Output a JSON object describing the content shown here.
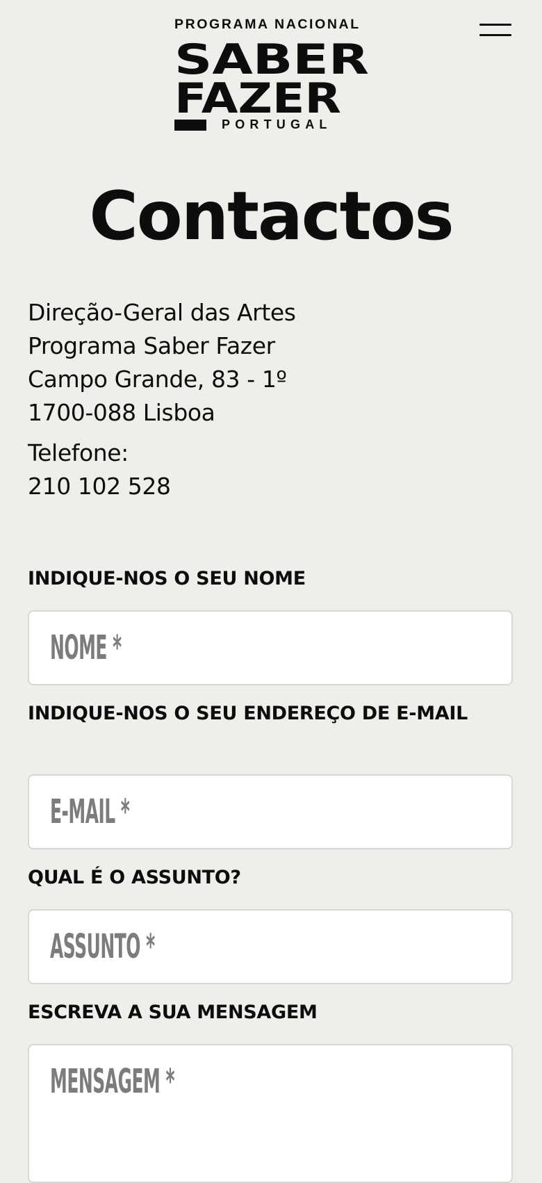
{
  "header": {
    "logo": {
      "top_text": "PROGRAMA NACIONAL",
      "line1": "SABER",
      "line2": "FAZER",
      "bottom_text": "PORTUGAL"
    },
    "menu_icon": "hamburger-menu-icon"
  },
  "page": {
    "title": "Contactos"
  },
  "address": {
    "lines": [
      "Direção-Geral das Artes",
      "Programa Saber Fazer",
      "Campo Grande, 83 - 1º",
      "1700-088 Lisboa"
    ],
    "phone_label": "Telefone:",
    "phone_number": "210 102 528"
  },
  "form": {
    "name": {
      "label": "INDIQUE-NOS O SEU NOME",
      "placeholder": "NOME *"
    },
    "email": {
      "label": "INDIQUE-NOS O SEU ENDEREÇO DE E-MAIL",
      "placeholder": "E-MAIL *"
    },
    "subject": {
      "label": "QUAL É O ASSUNTO?",
      "placeholder": "ASSUNTO *"
    },
    "message": {
      "label": "ESCREVA A SUA MENSAGEM",
      "placeholder": "MENSAGEM *"
    }
  },
  "colors": {
    "background": "#efeeea",
    "text": "#0d0d0d",
    "placeholder": "#7c7c7c",
    "field_background": "#ffffff",
    "field_border": "#d8d7d3"
  }
}
